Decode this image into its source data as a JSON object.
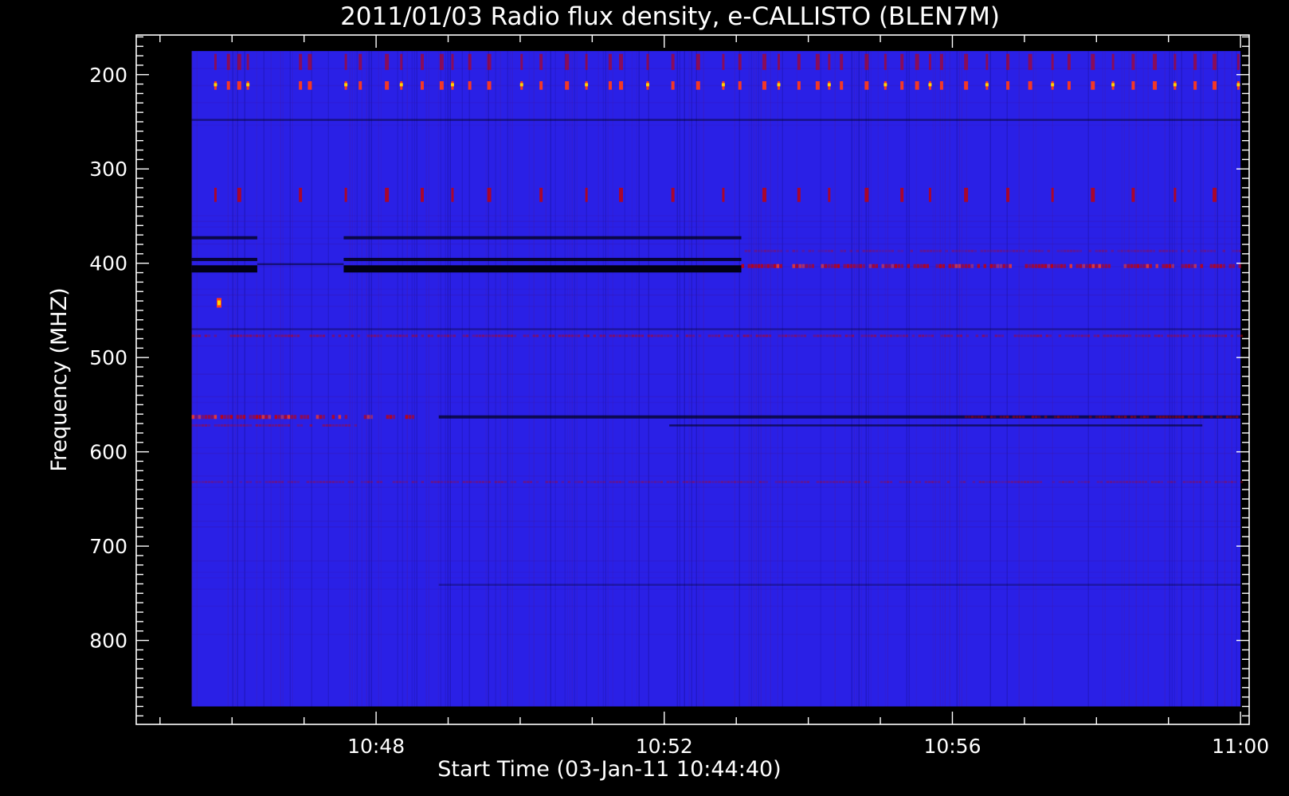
{
  "chart_data": {
    "type": "heatmap",
    "title": "2011/01/03  Radio flux density, e-CALLISTO (BLEN7M)",
    "xlabel": "Start Time (03-Jan-11 10:44:40)",
    "ylabel": "Frequency (MHZ)",
    "x_axis": {
      "unit": "minutes after 10:44:40",
      "range": [
        0.0,
        15.45
      ],
      "data_extent": [
        0.77,
        15.33
      ],
      "major_ticks": [
        {
          "value": 3.33,
          "label": "10:48"
        },
        {
          "value": 7.33,
          "label": "10:52"
        },
        {
          "value": 11.33,
          "label": "10:56"
        },
        {
          "value": 15.33,
          "label": "11:00"
        }
      ],
      "minor_step": 1.0
    },
    "y_axis": {
      "unit": "MHz",
      "inverted": true,
      "range": [
        158,
        889
      ],
      "data_extent": [
        175,
        870
      ],
      "major_ticks": [
        {
          "value": 200,
          "label": "200"
        },
        {
          "value": 300,
          "label": "300"
        },
        {
          "value": 400,
          "label": "400"
        },
        {
          "value": 500,
          "label": "500"
        },
        {
          "value": 600,
          "label": "600"
        },
        {
          "value": 700,
          "label": "700"
        },
        {
          "value": 800,
          "label": "800"
        }
      ],
      "minor_step": 10
    },
    "colormap": {
      "background": "#2a20e6",
      "low": "#000014",
      "high_1": "#c80000",
      "high_2": "#ff3a1a",
      "peak": "#ffd400"
    },
    "features": {
      "dark_bands": [
        {
          "freq": 373,
          "t_start": 0.77,
          "t_end": 1.68,
          "strength": 0.75
        },
        {
          "freq": 373,
          "t_start": 2.88,
          "t_end": 8.4,
          "strength": 0.75
        },
        {
          "freq": 396,
          "t_start": 0.77,
          "t_end": 1.68,
          "strength": 0.85
        },
        {
          "freq": 396,
          "t_start": 2.88,
          "t_end": 8.4,
          "strength": 0.85
        },
        {
          "freq": 406,
          "t_start": 0.77,
          "t_end": 1.68,
          "strength": 1.0
        },
        {
          "freq": 406,
          "t_start": 2.88,
          "t_end": 8.4,
          "strength": 1.0
        },
        {
          "freq": 401,
          "t_start": 1.68,
          "t_end": 2.88,
          "strength": 0.5
        },
        {
          "freq": 248,
          "t_start": 0.77,
          "t_end": 15.33,
          "strength": 0.45
        },
        {
          "freq": 470,
          "t_start": 0.77,
          "t_end": 15.33,
          "strength": 0.3
        },
        {
          "freq": 563,
          "t_start": 4.2,
          "t_end": 15.33,
          "strength": 0.7
        },
        {
          "freq": 572,
          "t_start": 7.4,
          "t_end": 14.8,
          "strength": 0.6
        },
        {
          "freq": 741,
          "t_start": 4.2,
          "t_end": 15.33,
          "strength": 0.3
        }
      ],
      "emission_bands": [
        {
          "freq": 403,
          "t_start": 8.4,
          "t_end": 15.33,
          "strength": 0.9
        },
        {
          "freq": 387,
          "t_start": 8.4,
          "t_end": 15.33,
          "strength": 0.35
        },
        {
          "freq": 563,
          "t_start": 0.77,
          "t_end": 3.9,
          "strength": 0.9
        },
        {
          "freq": 572,
          "t_start": 0.77,
          "t_end": 3.2,
          "strength": 0.5
        },
        {
          "freq": 563,
          "t_start": 11.5,
          "t_end": 15.33,
          "strength": 0.6
        },
        {
          "freq": 477,
          "t_start": 0.77,
          "t_end": 15.33,
          "strength": 0.55
        },
        {
          "freq": 632,
          "t_start": 0.77,
          "t_end": 15.33,
          "strength": 0.35
        }
      ],
      "burst_times": [
        1.1,
        1.28,
        1.43,
        1.55,
        2.28,
        2.41,
        2.91,
        3.11,
        3.48,
        3.68,
        3.97,
        4.24,
        4.39,
        4.63,
        4.9,
        5.35,
        5.62,
        5.98,
        6.25,
        6.58,
        6.73,
        7.1,
        7.45,
        7.8,
        8.15,
        8.38,
        8.72,
        8.92,
        9.2,
        9.46,
        9.62,
        9.79,
        10.14,
        10.4,
        10.63,
        10.84,
        11.02,
        11.18,
        11.52,
        11.81,
        12.1,
        12.41,
        12.72,
        12.95,
        13.28,
        13.56,
        13.84,
        14.14,
        14.42,
        14.7,
        14.97,
        15.3
      ],
      "hot_spot": {
        "t": 1.15,
        "freq": 442
      }
    }
  }
}
